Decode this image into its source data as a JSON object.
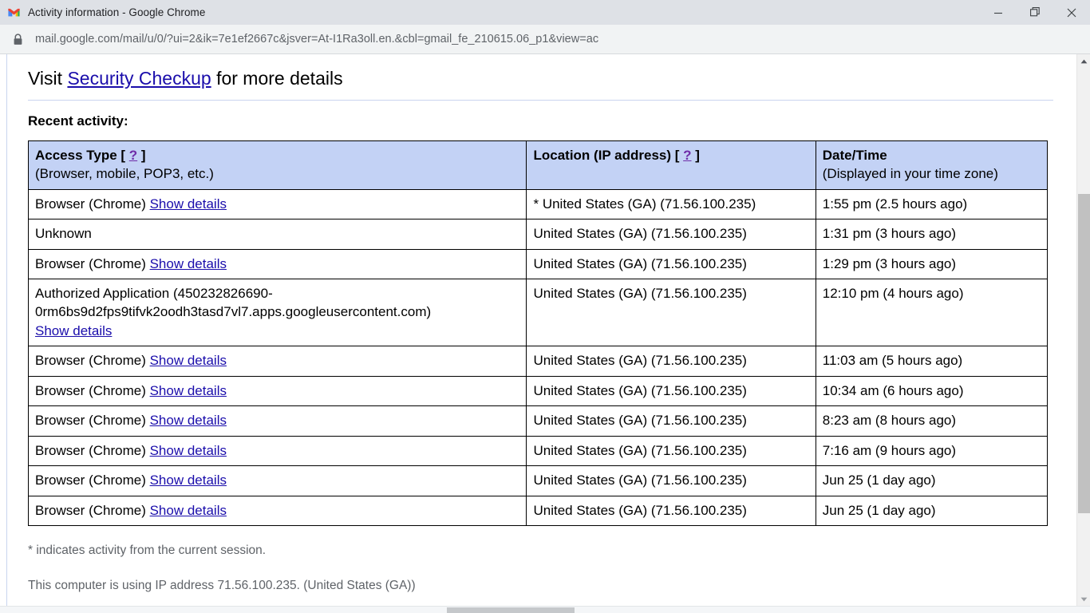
{
  "window": {
    "title": "Activity information - Google Chrome",
    "favicon": "gmail-logo-icon",
    "controls": {
      "minimize_label": "Minimize",
      "restore_label": "Restore",
      "close_label": "Close"
    }
  },
  "address_bar": {
    "lock_icon": "lock-icon",
    "url": "mail.google.com/mail/u/0/?ui=2&ik=7e1ef2667c&jsver=At-I1Ra3oll.en.&cbl=gmail_fe_210615.06_p1&view=ac"
  },
  "page": {
    "visit_prefix": "Visit ",
    "security_checkup_link": "Security Checkup",
    "visit_suffix": " for more details",
    "recent_activity_heading": "Recent activity:",
    "table": {
      "headers": [
        {
          "title": "Access Type [ ",
          "help": "?",
          "title_end": " ]",
          "subtitle": "(Browser, mobile, POP3, etc.)"
        },
        {
          "title": "Location (IP address) [ ",
          "help": "?",
          "title_end": " ]",
          "subtitle": ""
        },
        {
          "title": "Date/Time",
          "help": "",
          "title_end": "",
          "subtitle": "(Displayed in your time zone)"
        }
      ],
      "rows": [
        {
          "access_type": "Browser (Chrome)",
          "details_link": "Show details",
          "app_id": "",
          "location": "* United States (GA) (71.56.100.235)",
          "datetime": "1:55 pm (2.5 hours ago)"
        },
        {
          "access_type": "Unknown",
          "details_link": "",
          "app_id": "",
          "location": "United States (GA) (71.56.100.235)",
          "datetime": "1:31 pm (3 hours ago)"
        },
        {
          "access_type": "Browser (Chrome)",
          "details_link": "Show details",
          "app_id": "",
          "location": "United States (GA) (71.56.100.235)",
          "datetime": "1:29 pm (3 hours ago)"
        },
        {
          "access_type": "Authorized Application (450232826690-",
          "details_link": "Show details",
          "app_id": "0rm6bs9d2fps9tifvk2oodh3tasd7vl7.apps.googleusercontent.com)",
          "location": "United States (GA) (71.56.100.235)",
          "datetime": "12:10 pm (4 hours ago)"
        },
        {
          "access_type": "Browser (Chrome)",
          "details_link": "Show details",
          "app_id": "",
          "location": "United States (GA) (71.56.100.235)",
          "datetime": "11:03 am (5 hours ago)"
        },
        {
          "access_type": "Browser (Chrome)",
          "details_link": "Show details",
          "app_id": "",
          "location": "United States (GA) (71.56.100.235)",
          "datetime": "10:34 am (6 hours ago)"
        },
        {
          "access_type": "Browser (Chrome)",
          "details_link": "Show details",
          "app_id": "",
          "location": "United States (GA) (71.56.100.235)",
          "datetime": "8:23 am (8 hours ago)"
        },
        {
          "access_type": "Browser (Chrome)",
          "details_link": "Show details",
          "app_id": "",
          "location": "United States (GA) (71.56.100.235)",
          "datetime": "7:16 am (9 hours ago)"
        },
        {
          "access_type": "Browser (Chrome)",
          "details_link": "Show details",
          "app_id": "",
          "location": "United States (GA) (71.56.100.235)",
          "datetime": "Jun 25 (1 day ago)"
        },
        {
          "access_type": "Browser (Chrome)",
          "details_link": "Show details",
          "app_id": "",
          "location": "United States (GA) (71.56.100.235)",
          "datetime": "Jun 25 (1 day ago)"
        }
      ]
    },
    "note_current_session": "* indicates activity from the current session.",
    "note_ip": "This computer is using IP address 71.56.100.235. (United States (GA))"
  },
  "colors": {
    "link": "#1a0dab",
    "visited_link": "#6f2da8",
    "table_header_bg": "#c3d2f5",
    "titlebar_bg": "#dee1e6",
    "addressbar_bg": "#f1f3f4"
  },
  "scrollbars": {
    "vertical_present": true,
    "horizontal_present": true
  }
}
